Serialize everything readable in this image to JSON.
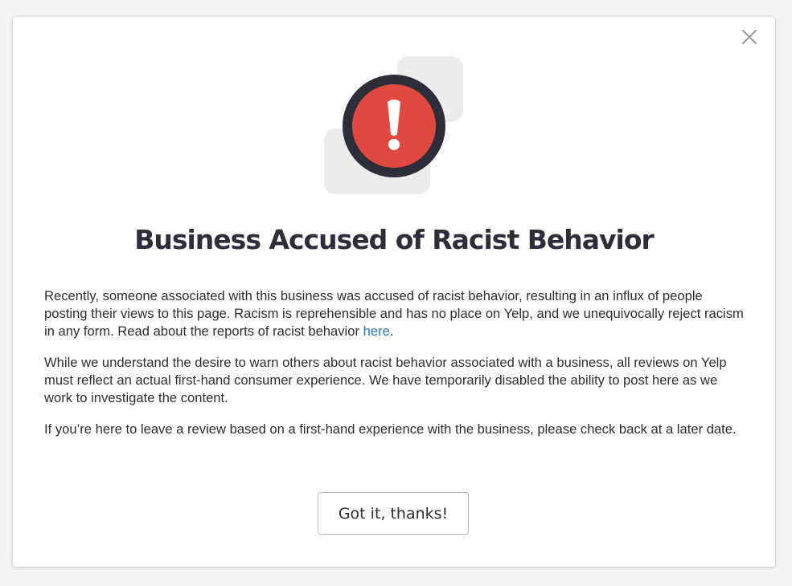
{
  "modal": {
    "title": "Business Accused of Racist Behavior",
    "paragraph1": "Recently, someone associated with this business was accused of racist behavior, resulting in an influx of people posting their views to this page. Racism is reprehensible and has no place on Yelp, and we unequivocally reject racism in any form. Read about the reports of racist behavior ",
    "paragraph1_link": "here",
    "paragraph1_end": ".",
    "paragraph2": "While we understand the desire to warn others about racist behavior associated with a business, all reviews on Yelp must reflect an actual first-hand consumer experience. We have temporarily disabled the ability to post here as we work to investigate the content.",
    "paragraph3": "If you’re here to leave a review based on a first-hand experience with the business, please check back at a later date.",
    "button_label": "Got it, thanks!"
  },
  "icons": {
    "close": "close-icon",
    "alert": "exclamation-alert-icon"
  },
  "colors": {
    "alert_red": "#e0493f",
    "alert_ring": "#2d2e3a",
    "link": "#2b72b8",
    "title": "#2d2e3a"
  }
}
